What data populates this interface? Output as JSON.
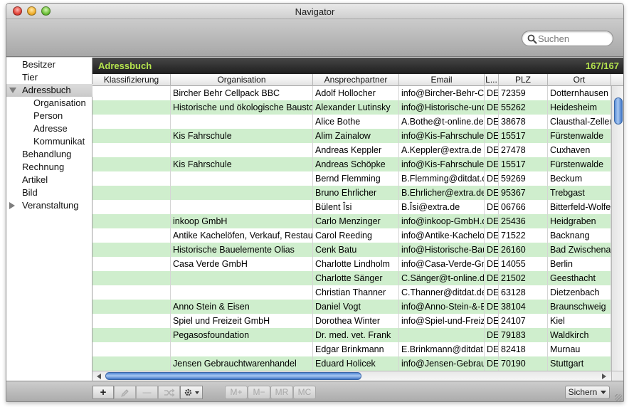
{
  "window": {
    "title": "Navigator"
  },
  "search": {
    "placeholder": "Suchen"
  },
  "sidebar": {
    "items": [
      {
        "label": "Besitzer",
        "indent": 0,
        "disclosure": "none",
        "selected": false
      },
      {
        "label": "Tier",
        "indent": 0,
        "disclosure": "none",
        "selected": false
      },
      {
        "label": "Adressbuch",
        "indent": 0,
        "disclosure": "open",
        "selected": true
      },
      {
        "label": "Organisation",
        "indent": 1,
        "disclosure": "none",
        "selected": false
      },
      {
        "label": "Person",
        "indent": 1,
        "disclosure": "none",
        "selected": false
      },
      {
        "label": "Adresse",
        "indent": 1,
        "disclosure": "none",
        "selected": false
      },
      {
        "label": "Kommunikat",
        "indent": 1,
        "disclosure": "none",
        "selected": false
      },
      {
        "label": "Behandlung",
        "indent": 0,
        "disclosure": "none",
        "selected": false
      },
      {
        "label": "Rechnung",
        "indent": 0,
        "disclosure": "none",
        "selected": false
      },
      {
        "label": "Artikel",
        "indent": 0,
        "disclosure": "none",
        "selected": false
      },
      {
        "label": "Bild",
        "indent": 0,
        "disclosure": "none",
        "selected": false
      },
      {
        "label": "Veranstaltung",
        "indent": 0,
        "disclosure": "closed",
        "selected": false
      }
    ]
  },
  "panel": {
    "title": "Adressbuch",
    "count": "167/167"
  },
  "table": {
    "columns": [
      "Klassifizierung",
      "Organisation",
      "Ansprechpartner",
      "Email",
      "L...",
      "PLZ",
      "Ort"
    ],
    "rows": [
      {
        "green": false,
        "cells": [
          "",
          "Bircher Behr Cellpack BBC",
          "Adolf Hollocher",
          "info@Bircher-Behr-Cellpack.de",
          "DE",
          "72359",
          "Dotternhausen"
        ]
      },
      {
        "green": true,
        "cells": [
          "",
          "Historische und ökologische Baustoffe",
          "Alexander Lutinsky",
          "info@Historische-und-oekologische.de",
          "DE",
          "55262",
          "Heidesheim"
        ]
      },
      {
        "green": false,
        "cells": [
          "",
          "",
          "Alice Bothe",
          "A.Bothe@t-online.de",
          "DE",
          "38678",
          "Clausthal-Zellerfeld"
        ]
      },
      {
        "green": true,
        "cells": [
          "",
          "Kis Fahrschule",
          "Alim Zainalow",
          "info@Kis-Fahrschule.de",
          "DE",
          "15517",
          "Fürstenwalde"
        ]
      },
      {
        "green": false,
        "cells": [
          "",
          "",
          "Andreas Keppler",
          "A.Keppler@extra.de",
          "DE",
          "27478",
          "Cuxhaven"
        ]
      },
      {
        "green": true,
        "cells": [
          "",
          "Kis Fahrschule",
          "Andreas Schöpke",
          "info@Kis-Fahrschule.de",
          "DE",
          "15517",
          "Fürstenwalde"
        ]
      },
      {
        "green": false,
        "cells": [
          "",
          "",
          "Bernd Flemming",
          "B.Flemming@ditdat.de",
          "DE",
          "59269",
          "Beckum"
        ]
      },
      {
        "green": true,
        "cells": [
          "",
          "",
          "Bruno Ehrlicher",
          "B.Ehrlicher@extra.de",
          "DE",
          "95367",
          "Trebgast"
        ]
      },
      {
        "green": false,
        "cells": [
          "",
          "",
          "Bülent Îsi",
          "B.Îsi@extra.de",
          "DE",
          "06766",
          "Bitterfeld-Wolfen"
        ]
      },
      {
        "green": true,
        "cells": [
          "",
          "inkoop GmbH",
          "Carlo Menzinger",
          "info@inkoop-GmbH.de",
          "DE",
          "25436",
          "Heidgraben"
        ]
      },
      {
        "green": false,
        "cells": [
          "",
          "Antike Kachelöfen, Verkauf, Restaurierung",
          "Carol Reeding",
          "info@Antike-Kacheloefen.de",
          "DE",
          "71522",
          "Backnang"
        ]
      },
      {
        "green": true,
        "cells": [
          "",
          "Historische Bauelemente Olias",
          "Cenk Batu",
          "info@Historische-Bauelemente.de",
          "DE",
          "26160",
          "Bad Zwischenahn"
        ]
      },
      {
        "green": false,
        "cells": [
          "",
          "Casa Verde GmbH",
          "Charlotte Lindholm",
          "info@Casa-Verde-GmbH.de",
          "DE",
          "14055",
          "Berlin"
        ]
      },
      {
        "green": true,
        "cells": [
          "",
          "",
          "Charlotte Sänger",
          "C.Sänger@t-online.de",
          "DE",
          "21502",
          "Geesthacht"
        ]
      },
      {
        "green": false,
        "cells": [
          "",
          "",
          "Christian Thanner",
          "C.Thanner@ditdat.de",
          "DE",
          "63128",
          "Dietzenbach"
        ]
      },
      {
        "green": true,
        "cells": [
          "",
          "Anno Stein & Eisen",
          "Daniel Vogt",
          "info@Anno-Stein-&-Eisen.de",
          "DE",
          "38104",
          "Braunschweig"
        ]
      },
      {
        "green": false,
        "cells": [
          "",
          "Spiel und Freizeit GmbH",
          "Dorothea Winter",
          "info@Spiel-und-Freizeit.de",
          "DE",
          "24107",
          "Kiel"
        ]
      },
      {
        "green": true,
        "cells": [
          "",
          "Pegasosfoundation",
          "Dr. med. vet. Frank",
          "",
          "DE",
          "79183",
          "Waldkirch"
        ]
      },
      {
        "green": false,
        "cells": [
          "",
          "",
          "Edgar Brinkmann",
          "E.Brinkmann@ditdat.de",
          "DE",
          "82418",
          "Murnau"
        ]
      },
      {
        "green": true,
        "cells": [
          "",
          "Jensen Gebrauchtwarenhandel",
          "Eduard Holicek",
          "info@Jensen-Gebrauchtwaren.de",
          "DE",
          "70190",
          "Stuttgart"
        ]
      }
    ]
  },
  "bottombar": {
    "add_label": "+",
    "remove_label": "—",
    "m_plus": "M+",
    "m_minus": "M−",
    "mr": "MR",
    "mc": "MC",
    "save_label": "Sichern"
  },
  "colors": {
    "accent_green": "#b5e34e",
    "row_green": "#cfeecd",
    "scroll_blue": "#5b8fd8"
  }
}
